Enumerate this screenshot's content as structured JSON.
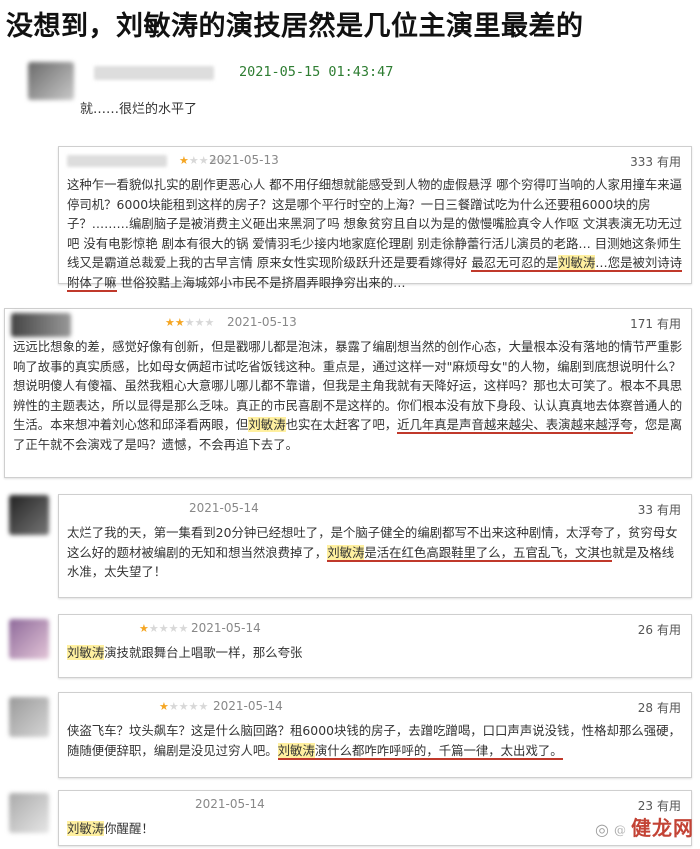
{
  "headline": "没想到，刘敏涛的演技居然是几位主演里最差的",
  "reviews": [
    {
      "date": "2021-05-15 01:43:47",
      "text": "就……很烂的水平了"
    },
    {
      "date": "2021-05-13",
      "useful_count": "333",
      "useful_label": "有用",
      "stars": "★★★★★",
      "text_a": "这种乍一看貌似扎实的剧作更恶心人 都不用仔细想就能感受到人物的虚假悬浮 哪个穷得叮当响的人家用撞车来逼停司机？6000块能租到这样的房子？这是哪个平行时空的上海？一日三餐蹭试吃为什么还要租6000块的房子？………编剧脑子是被消费主义砸出来黑洞了吗 想象贫穷且自以为是的傲慢嘴脸真令人作呕 文淇表演无功无过吧 没有电影惊艳 剧本有很大的锅 爱情羽毛少接内地家庭伦理剧 别走徐静蕾行活儿演员的老路… 目测她这条师生线又是霸道总裁爱上我的古早言情 原来女性实现阶级跃升还是要看嫁得好 ",
      "text_ul1": "最忍无可忍的是",
      "text_name": "刘敏涛",
      "text_ul2": "…您是被刘诗诗附体了嘛",
      "text_b": " 世俗狡黠上海城郊小市民不是挤眉弄眼挣穷出来的…"
    },
    {
      "date": "2021-05-13",
      "useful_count": "171",
      "useful_label": "有用",
      "stars": "★★★★★",
      "text_a": "远远比想象的差，感觉好像有创新，但是戳哪儿都是泡沫，暴露了编剧想当然的创作心态，大量根本没有落地的情节严重影响了故事的真实质感，比如母女俩超市试吃省饭钱这种。重点是，通过这样一对\"麻烦母女\"的人物，编剧到底想说明什么？想说明傻人有傻福、虽然我粗心大意哪儿哪儿都不靠谱，但我是主角我就有天降好运，这样吗？那也太可笑了。根本不具思辨性的主题表达，所以显得是那么乏味。真正的市民喜剧不是这样的。你们根本没有放下身段、认认真真地去体察普通人的生活。本来想冲着刘心悠和邱泽看两眼，但",
      "text_name": "刘敏涛",
      "text_b": "也实在太赶客了吧，",
      "text_ul1": "近几年真是声音越来越尖、表演越来越浮夸",
      "text_c": "，您是离了正午就不会演戏了是吗？遗憾，不会再追下去了。"
    },
    {
      "date": "2021-05-14",
      "useful_count": "33",
      "useful_label": "有用",
      "text_a": "太烂了我的天，第一集看到20分钟已经想吐了，是个脑子健全的编剧都写不出来这种剧情，太浮夸了，贫穷母女这么好的题材被编剧的无知和想当然浪费掉了，",
      "text_name": "刘敏涛",
      "text_ul1": "是活在红色高跟鞋里了么，五官乱飞，文淇也",
      "text_b": "就是及格线水准，太失望了！"
    },
    {
      "date": "2021-05-14",
      "useful_count": "26",
      "useful_label": "有用",
      "stars": "★★★★★",
      "text_name": "刘敏涛",
      "text_a": "演技就跟舞台上唱歌一样，那么夸张"
    },
    {
      "date": "2021-05-14",
      "useful_count": "28",
      "useful_label": "有用",
      "stars": "★★★★★",
      "text_a": "侠盗飞车？坟头飙车？这是什么脑回路？租6000块钱的房子，去蹭吃蹭喝，口口声声说没钱，性格却那么强硬，随随便便辞职，编剧是没见过穷人吧。",
      "text_name": "刘敏涛",
      "text_ul1": "演什么都咋咋呼呼的，千篇一律，太出戏了。"
    },
    {
      "date": "2021-05-14",
      "useful_count": "23",
      "useful_label": "有用",
      "text_name": "刘敏涛",
      "text_a": "你醒醒！"
    }
  ],
  "watermark": {
    "brand": "健龙网",
    "prefix": "@"
  },
  "colors": {
    "highlight": "#fff0a0",
    "underline": "#c0392b",
    "star_on": "#f5a623",
    "watermark": "#c0392b"
  }
}
